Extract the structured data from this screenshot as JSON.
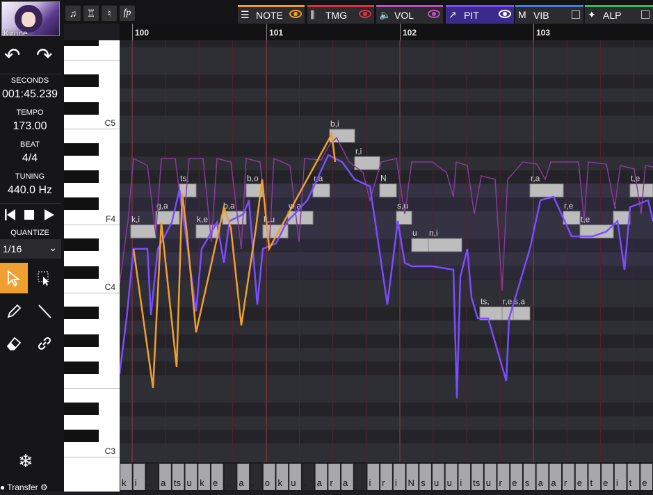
{
  "singer": {
    "name": "Kirune"
  },
  "sidebar": {
    "seconds_label": "SECONDS",
    "seconds": "001:45.239",
    "tempo_label": "TEMPO",
    "tempo": "173.00",
    "beat_label": "BEAT",
    "beat": "4/4",
    "tuning_label": "TUNING",
    "tuning": "440.0 Hz",
    "quantize_label": "QUANTIZE",
    "quantize": "1/16",
    "transfer_label": "Transfer"
  },
  "tabs": [
    {
      "label": "NOTE",
      "color": "#f0a030",
      "icon": "note-icon",
      "state": "eye"
    },
    {
      "label": "TMG",
      "color": "#e03040",
      "icon": "timing-icon",
      "state": "eye"
    },
    {
      "label": "VOL",
      "color": "#c050c0",
      "icon": "volume-icon",
      "state": "eye"
    },
    {
      "label": "PIT",
      "color": "#7a4dff",
      "icon": "pitch-icon",
      "state": "eye",
      "active": true
    },
    {
      "label": "VIB",
      "color": "#4080e0",
      "icon": "vibrato-icon",
      "state": "checkbox"
    },
    {
      "label": "ALP",
      "color": "#30c060",
      "icon": "alpha-icon",
      "state": "checkbox"
    }
  ],
  "measures": [
    "100",
    "101",
    "102",
    "103"
  ],
  "keys": {
    "c5": "C5",
    "f4": "F4",
    "c4": "C4",
    "c3": "C3"
  },
  "notes": [
    {
      "lyric": "k,i",
      "pitch": "E4"
    },
    {
      "lyric": "g,a",
      "pitch": "F4"
    },
    {
      "lyric": "ts,",
      "pitch": "G4"
    },
    {
      "lyric": "k,e",
      "pitch": "E4"
    },
    {
      "lyric": "b,a",
      "pitch": "F4"
    },
    {
      "lyric": "b,o",
      "pitch": "G4"
    },
    {
      "lyric": "k,u",
      "pitch": "E4"
    },
    {
      "lyric": "w,a",
      "pitch": "F4"
    },
    {
      "lyric": "r,a",
      "pitch": "G4"
    },
    {
      "lyric": "b,i",
      "pitch": "B4"
    },
    {
      "lyric": "r,i",
      "pitch": "A4"
    },
    {
      "lyric": "N",
      "pitch": "G4"
    },
    {
      "lyric": "s,u",
      "pitch": "F4"
    },
    {
      "lyric": "u",
      "pitch": "D#4"
    },
    {
      "lyric": "n,i",
      "pitch": "D#4"
    },
    {
      "lyric": "ts,",
      "pitch": "A#3"
    },
    {
      "lyric": "r,e",
      "pitch": "A#3"
    },
    {
      "lyric": "s,a",
      "pitch": "A#3"
    },
    {
      "lyric": "r,a",
      "pitch": "G4"
    },
    {
      "lyric": "r,e",
      "pitch": "F4"
    },
    {
      "lyric": "t,e",
      "pitch": "E4"
    },
    {
      "lyric": "i",
      "pitch": "F4"
    },
    {
      "lyric": "t,e",
      "pitch": "G4"
    }
  ],
  "lyrics": [
    "k",
    "i",
    ".",
    "a",
    "ts",
    "u",
    "k",
    "e",
    ".",
    "a",
    ".",
    "o",
    "k",
    "u",
    ".",
    "a",
    "r",
    "a",
    ".",
    "i",
    "r",
    "i",
    "N",
    "s",
    "u",
    "u",
    "i",
    "ts",
    "u",
    "r",
    "e",
    "s",
    "a",
    "a",
    "r",
    "e",
    "t",
    "e",
    "i",
    "t",
    "e"
  ]
}
